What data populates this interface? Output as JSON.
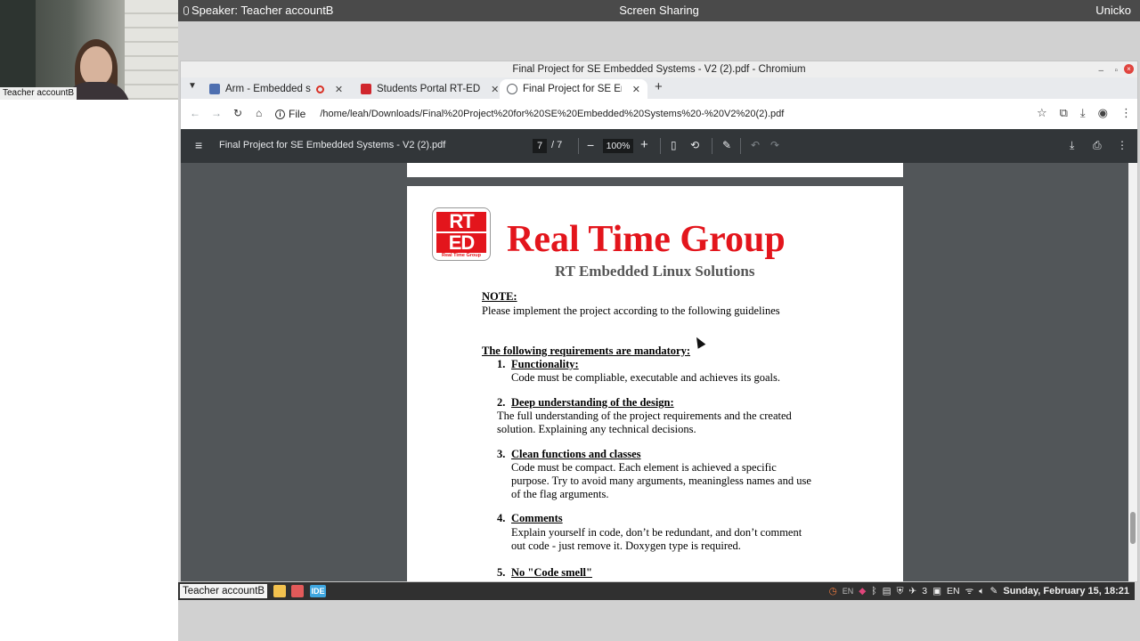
{
  "meeting": {
    "speaker": "Speaker: Teacher accountB",
    "title": "Screen Sharing",
    "user": "Unicko",
    "video_name": "Teacher accountB"
  },
  "browser": {
    "window_title": "Final Project for SE Embedded Systems - V2 (2).pdf - Chromium",
    "tabs": [
      {
        "label": "Arm  - Embedded s",
        "favicon_color": "#4e6fb0",
        "recording": true
      },
      {
        "label": "Students Portal RT-ED",
        "favicon_color": "#d0262d"
      },
      {
        "label": "Final Project for SE Em",
        "favicon_color": "#5f6368",
        "active": true
      }
    ],
    "file_chip": "File",
    "url": "/home/leah/Downloads/Final%20Project%20for%20SE%20Embedded%20Systems%20-%20V2%20(2).pdf"
  },
  "pdf_toolbar": {
    "doc_title": "Final Project for SE Embedded Systems - V2 (2).pdf",
    "page_current": "7",
    "page_total": "/ 7",
    "zoom": "100%"
  },
  "document": {
    "logo_top": "RT",
    "logo_bottom": "ED",
    "logo_caption": "Real Time Group",
    "title": "Real Time Group",
    "subtitle": "RT Embedded Linux Solutions",
    "note_heading": "NOTE:",
    "note_text": "Please implement the project according to the following guidelines",
    "mandatory_heading": "The following requirements are mandatory:",
    "items": [
      {
        "num": "1.",
        "heading": "Functionality:",
        "lines": [
          "Code must be compliable, executable and achieves its goals."
        ]
      },
      {
        "num": "2.",
        "heading": "Deep understanding of the design:",
        "lines": [
          "The full understanding of the project requirements and the created",
          "solution.  Explaining any technical decisions."
        ]
      },
      {
        "num": "3.",
        "heading": "Clean functions and classes",
        "lines": [
          "Code must be compact. Each element is achieved a specific",
          "purpose. Try to avoid many arguments, meaningless names and use",
          "of the flag arguments."
        ]
      },
      {
        "num": "4.",
        "heading": "Comments",
        "lines": [
          "Explain yourself in code, don’t be redundant, and don’t comment",
          "out code - just remove it. Doxygen type is required."
        ]
      },
      {
        "num": "5.",
        "heading": "No \"Code smell\"",
        "lines": []
      }
    ]
  },
  "taskbar": {
    "active_label": "Teacher accountB",
    "ide_label": "IDE",
    "lang1": "EN",
    "count": "3",
    "lang2": "EN",
    "datetime": "Sunday, February 15, 18:21"
  }
}
